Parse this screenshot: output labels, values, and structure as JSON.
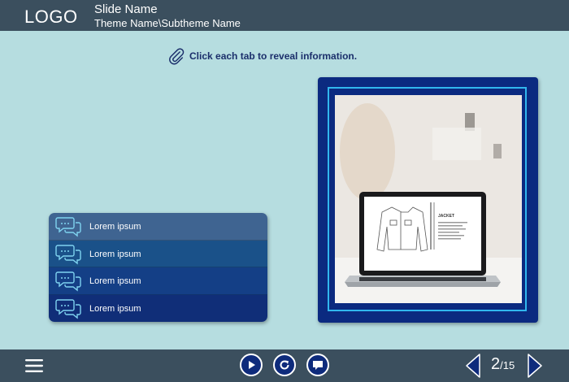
{
  "header": {
    "logo": "LOGO",
    "slide_name": "Slide Name",
    "theme_path": "Theme Name\\Subtheme Name"
  },
  "instruction": {
    "text": "Click each tab to reveal information.",
    "icon": "paperclip-icon"
  },
  "tabs": [
    {
      "label": "Lorem ipsum",
      "icon": "chat-bubbles-icon",
      "color": "#3f6491"
    },
    {
      "label": "Lorem ipsum",
      "icon": "chat-bubbles-icon",
      "color": "#1a5189"
    },
    {
      "label": "Lorem ipsum",
      "icon": "chat-bubbles-icon",
      "color": "#143f86"
    },
    {
      "label": "Lorem ipsum",
      "icon": "chat-bubbles-icon",
      "color": "#102e78"
    }
  ],
  "photo": {
    "screen_heading": "JACKET"
  },
  "footer": {
    "current_page": "2",
    "total_pages": "/15",
    "buttons": [
      "menu-icon",
      "play-icon",
      "replay-icon",
      "comment-icon",
      "prev-arrow-icon",
      "next-arrow-icon"
    ]
  },
  "colors": {
    "background": "#b6dde0",
    "bar": "#3b4f5e",
    "accent": "#0b2a80",
    "frame_line": "#31b7ee"
  }
}
